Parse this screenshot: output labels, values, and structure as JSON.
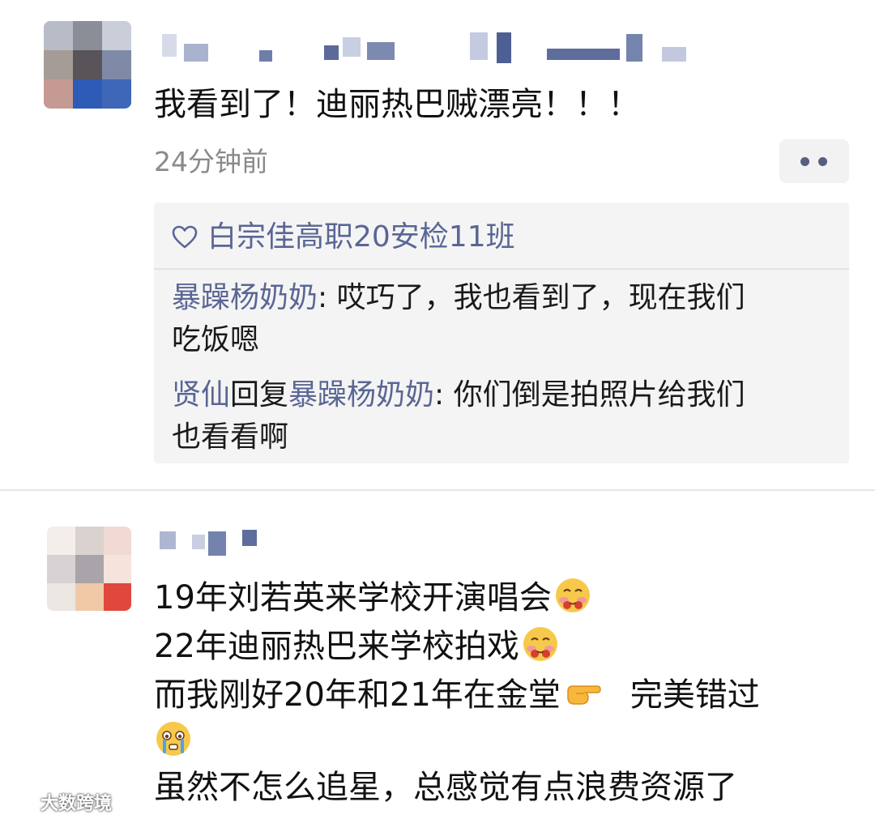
{
  "post1": {
    "text": "我看到了！迪丽热巴贼漂亮！！！",
    "time": "24分钟前",
    "likes": "白宗佳高职20安检11班",
    "comments": [
      {
        "user": "暴躁杨奶奶",
        "sep": ": ",
        "text_line1": "哎巧了，我也看到了，现在我们",
        "text_line2": "吃饭嗯"
      },
      {
        "user": "贤仙",
        "reply": "回复",
        "reply_to": "暴躁杨奶奶",
        "sep": ": ",
        "text_line1": "你们倒是拍照片给我们",
        "text_line2": "也看看啊"
      }
    ]
  },
  "post2": {
    "line1": "19年刘若英来学校开演唱会",
    "line2": "22年迪丽热巴来学校拍戏",
    "line3a": "而我刚好20年和21年在金堂",
    "line3b": "完美错过",
    "line5": "虽然不怎么追星，总感觉有点浪费资源了"
  },
  "watermark": "大数跨境",
  "colors": {
    "link": "#5a6694",
    "meta": "#8a8a8a",
    "panel": "#f4f4f4"
  }
}
